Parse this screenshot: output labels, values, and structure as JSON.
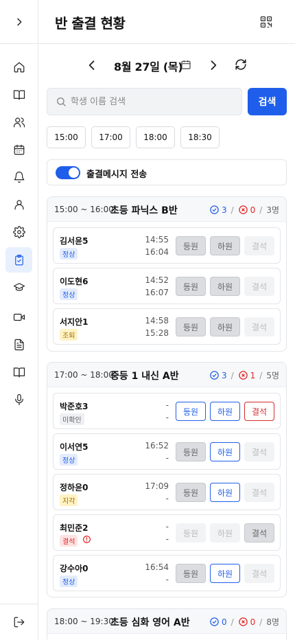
{
  "header": {
    "title": "반 출결 현황"
  },
  "date_nav": {
    "date": "8월 27일 (목)"
  },
  "search": {
    "placeholder": "학생 이름 검색",
    "button": "검색"
  },
  "time_filters": [
    "15:00",
    "17:00",
    "18:00",
    "18:30"
  ],
  "message_toggle": {
    "label": "출결메시지 전송",
    "on": true
  },
  "colors": {
    "accent": "#1f5eea",
    "danger": "#e02424"
  },
  "sidebar": {
    "items": [
      {
        "icon": "home-icon"
      },
      {
        "icon": "book-open-icon"
      },
      {
        "icon": "users-icon"
      },
      {
        "icon": "calendar-icon"
      },
      {
        "icon": "bell-icon"
      },
      {
        "icon": "user-icon"
      },
      {
        "icon": "settings-icon"
      },
      {
        "icon": "clipboard-check-icon",
        "active": true
      },
      {
        "icon": "graduation-cap-icon"
      },
      {
        "icon": "video-icon"
      },
      {
        "icon": "document-icon"
      },
      {
        "icon": "book-icon"
      },
      {
        "icon": "microphone-icon"
      }
    ],
    "bottom_icon": "logout-icon"
  },
  "classes": [
    {
      "time": "15:00 ~ 16:00",
      "name": "초등 파닉스 B반",
      "present": "3",
      "absent": "0",
      "total": "3명",
      "students": [
        {
          "name": "김서윤5",
          "status": "정상",
          "in": "14:55",
          "out": "16:04"
        },
        {
          "name": "이도현6",
          "status": "정상",
          "in": "14:52",
          "out": "16:07"
        },
        {
          "name": "서지안1",
          "status": "조퇴",
          "in": "14:58",
          "out": "15:28"
        }
      ]
    },
    {
      "time": "17:00 ~ 18:00",
      "name": "중등 1 내신 A반",
      "present": "3",
      "absent": "1",
      "total": "5명",
      "students": [
        {
          "name": "박준호3",
          "status": "미확인",
          "in": "-",
          "out": "-"
        },
        {
          "name": "이서연5",
          "status": "정상",
          "in": "16:52",
          "out": "-"
        },
        {
          "name": "정하윤0",
          "status": "지각",
          "in": "17:09",
          "out": "-"
        },
        {
          "name": "최민준2",
          "status": "결석",
          "in": "-",
          "out": "-"
        },
        {
          "name": "강수아0",
          "status": "정상",
          "in": "16:54",
          "out": "-"
        }
      ]
    },
    {
      "time": "18:00 ~ 19:30",
      "name": "초등 심화 영어 A반",
      "present": "0",
      "absent": "0",
      "total": "8명",
      "students": []
    }
  ],
  "buttons": {
    "checkin": "등원",
    "checkout": "하원",
    "absent": "결석"
  }
}
